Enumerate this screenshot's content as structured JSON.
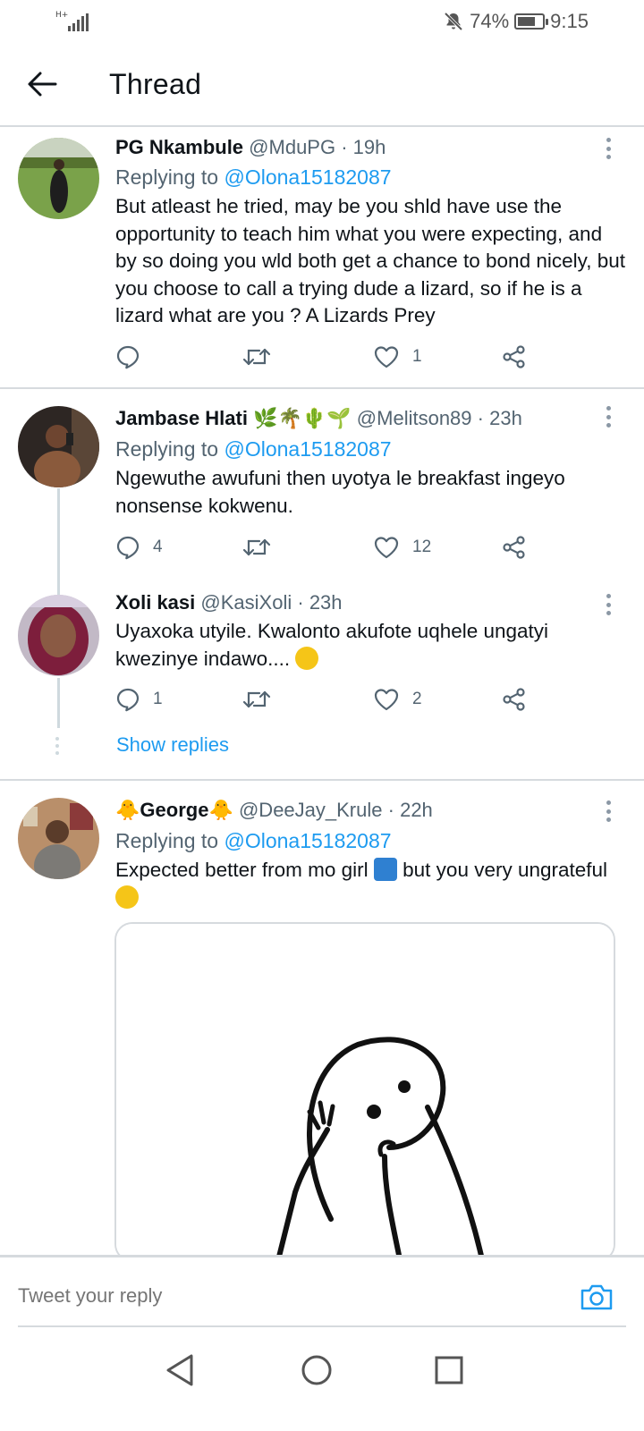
{
  "status_bar": {
    "network": "H+",
    "battery": "74%",
    "battery_level": 0.74,
    "time": "9:15"
  },
  "header": {
    "title": "Thread"
  },
  "tweets": [
    {
      "name": "PG Nkambule",
      "handle": "@MduPG",
      "time": "19h",
      "replying_label": "Replying to",
      "replying_to": "@Olona15182087",
      "text": "But atleast he tried, may be you shld have use the opportunity to teach him what you were expecting, and by so doing you wld both get a chance to bond nicely, but you choose to call a trying dude a lizard, so if he is a lizard what are you ? A Lizards Prey",
      "reply_count": "",
      "retweet_count": "",
      "like_count": "1"
    },
    {
      "name": "Jambase Hlati",
      "name_emoji": "🌿🌴🌵🌱",
      "handle": "@Melitson89",
      "time": "23h",
      "replying_label": "Replying to",
      "replying_to": "@Olona15182087",
      "text": "Ngewuthe awufuni then uyotya le breakfast ingeyo nonsense kokwenu.",
      "reply_count": "4",
      "retweet_count": "",
      "like_count": "12"
    },
    {
      "name": "Xoli kasi",
      "handle": "@KasiXoli",
      "time": "23h",
      "text": "Uyaxoka utyile. Kwalonto akufote uqhele ungatyi kwezinye indawo....",
      "text_emoji": "🤭",
      "reply_count": "1",
      "retweet_count": "",
      "like_count": "2",
      "show_replies": "Show replies"
    },
    {
      "name": "George",
      "name_emoji": "🐥",
      "handle": "@DeeJay_Krule",
      "time": "22h",
      "replying_label": "Replying to",
      "replying_to": "@Olona15182087",
      "text": "Expected better from mo girl",
      "text_emoji_1": "🚮",
      "text_2": "but you very ungrateful",
      "text_emoji_2": "😒"
    }
  ],
  "reply_bar": {
    "placeholder": "Tweet your reply"
  },
  "icons": {
    "back": "arrow-left-icon",
    "reply": "speech-bubble-icon",
    "retweet": "retweet-icon",
    "like": "heart-icon",
    "share": "share-icon",
    "camera": "camera-icon",
    "more": "more-vertical-icon",
    "nav_back": "triangle-back-icon",
    "nav_home": "circle-home-icon",
    "nav_recents": "square-recents-icon"
  },
  "colors": {
    "accent": "#1d9bf0",
    "text_primary": "#0f1419",
    "text_secondary": "#536471",
    "divider": "#d6dade"
  }
}
